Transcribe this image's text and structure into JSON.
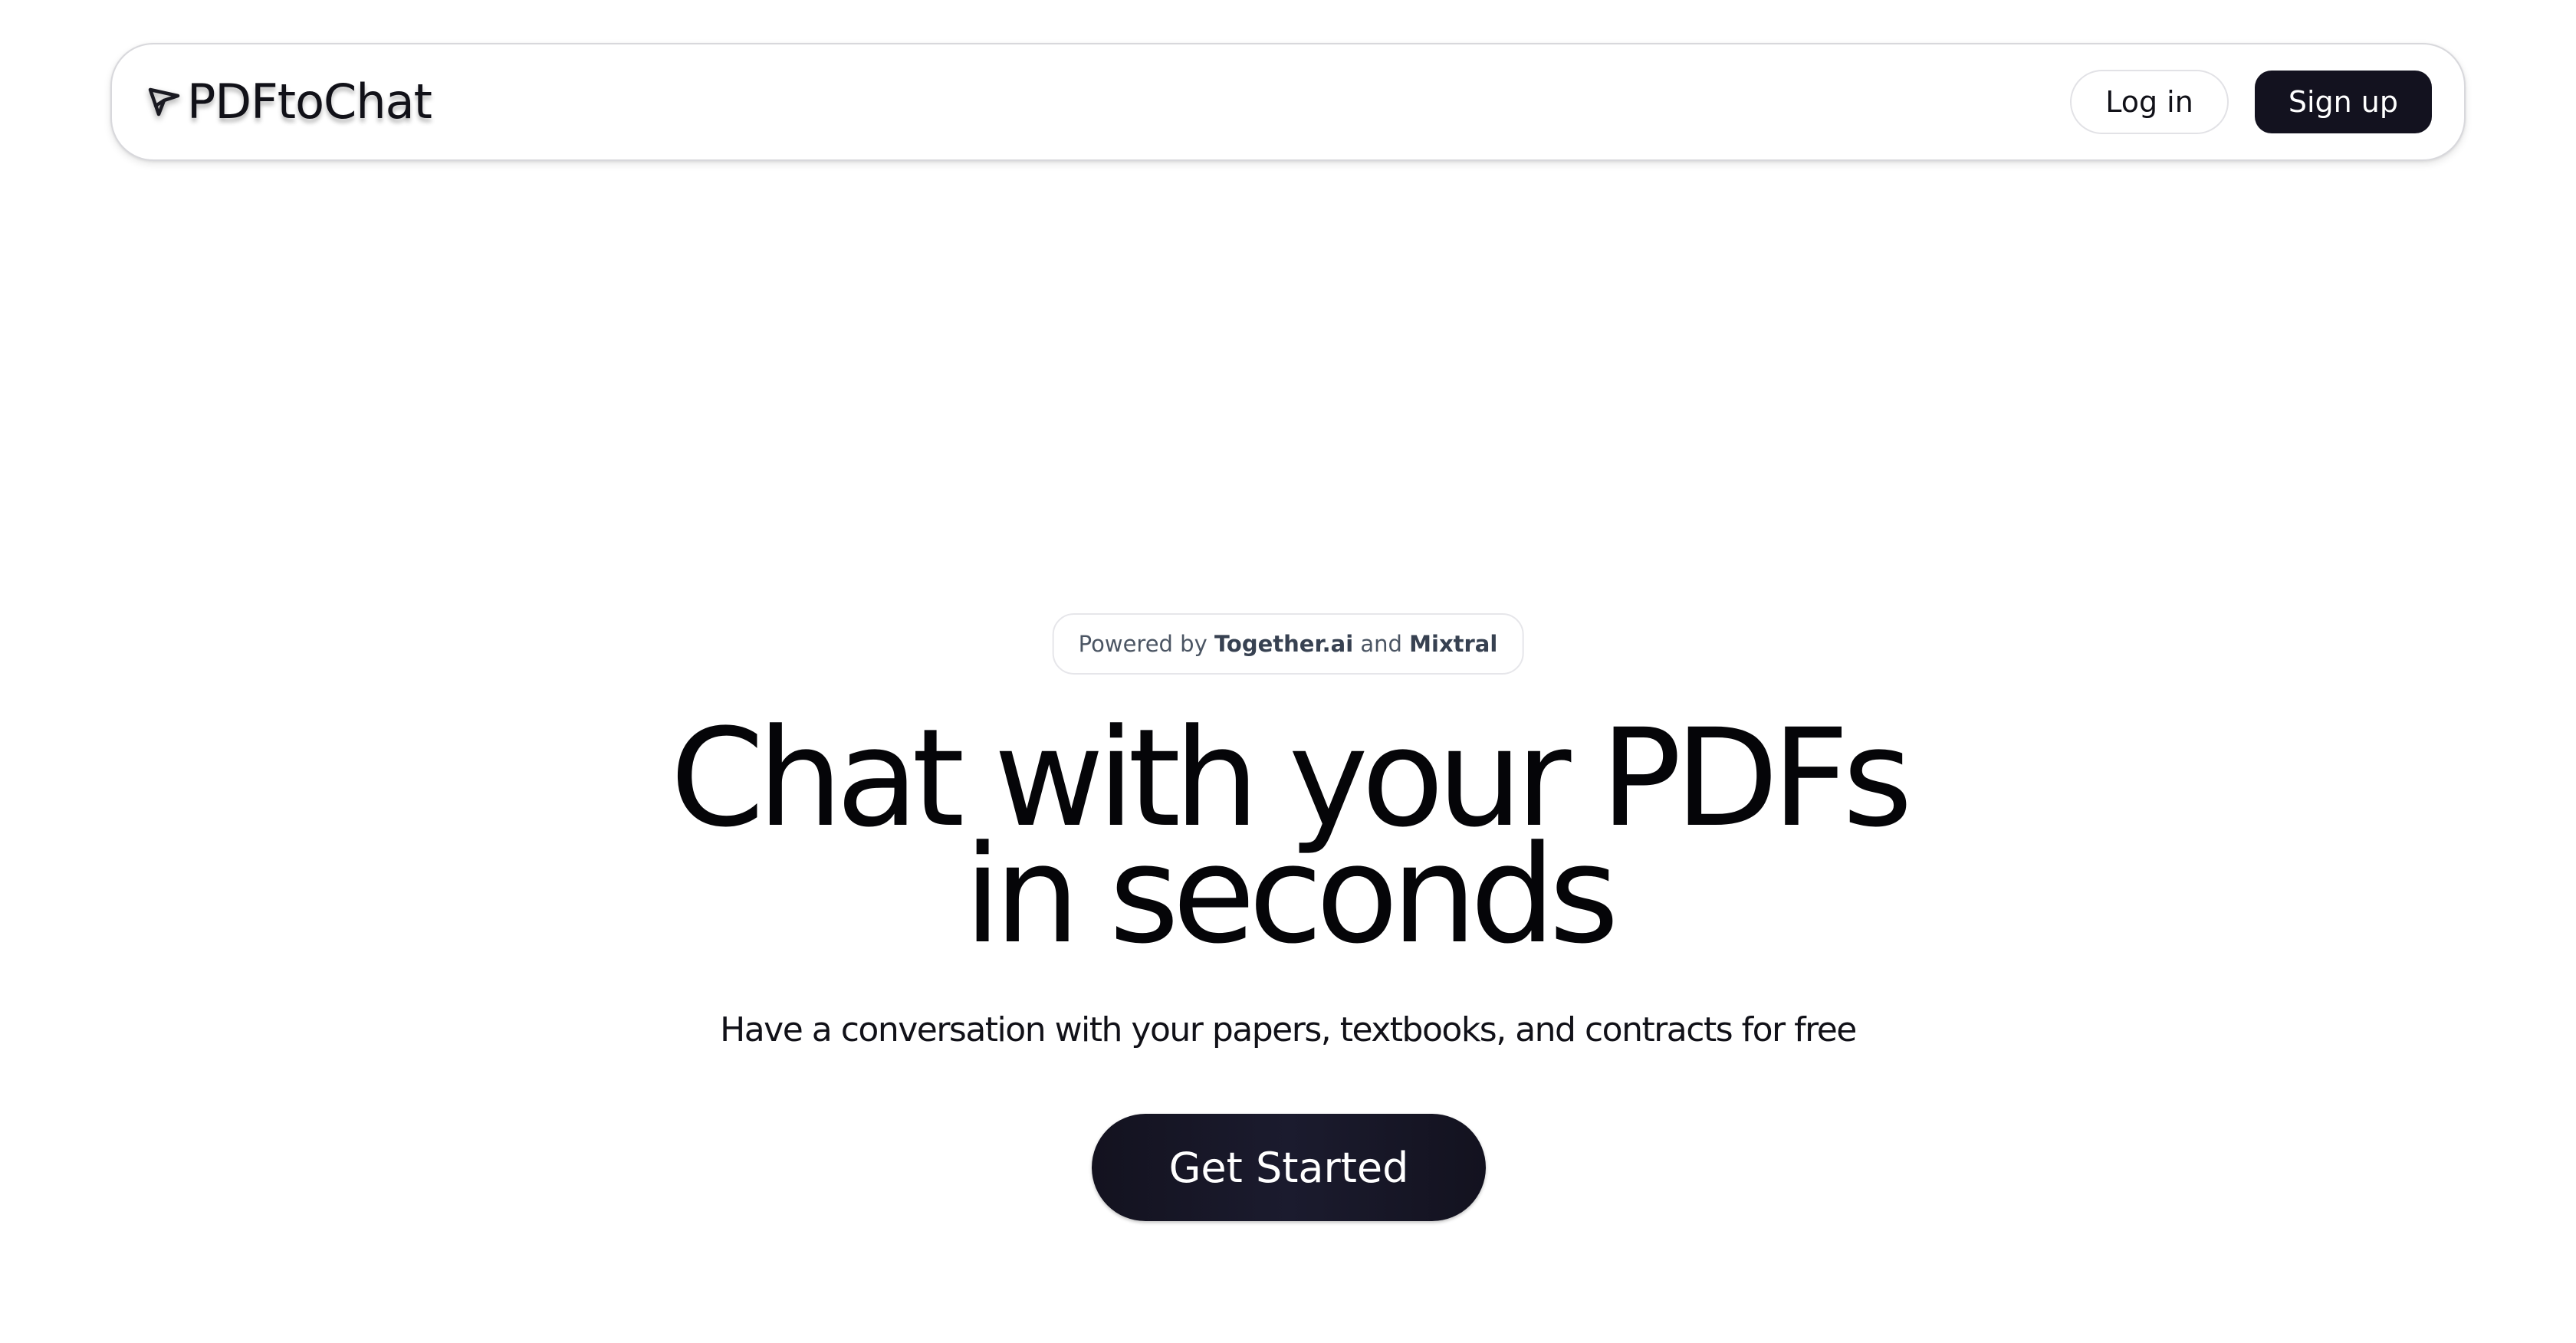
{
  "header": {
    "brand": {
      "icon": "send-arrow-icon",
      "name": "PDFtoChat"
    },
    "login_label": "Log in",
    "signup_label": "Sign up"
  },
  "hero": {
    "badge": {
      "prefix": "Powered by",
      "provider": "Together.ai",
      "joiner": "and",
      "model": "Mixtral"
    },
    "title_line1": "Chat with your PDFs",
    "title_line2": "in seconds",
    "subtitle": "Have a conversation with your papers, textbooks, and contracts for free",
    "cta_label": "Get Started"
  },
  "colors": {
    "primary_dark": "#13121f",
    "background": "#ffffff",
    "border": "#d8d8dc",
    "text": "#050508",
    "muted_text": "#4b5563"
  }
}
